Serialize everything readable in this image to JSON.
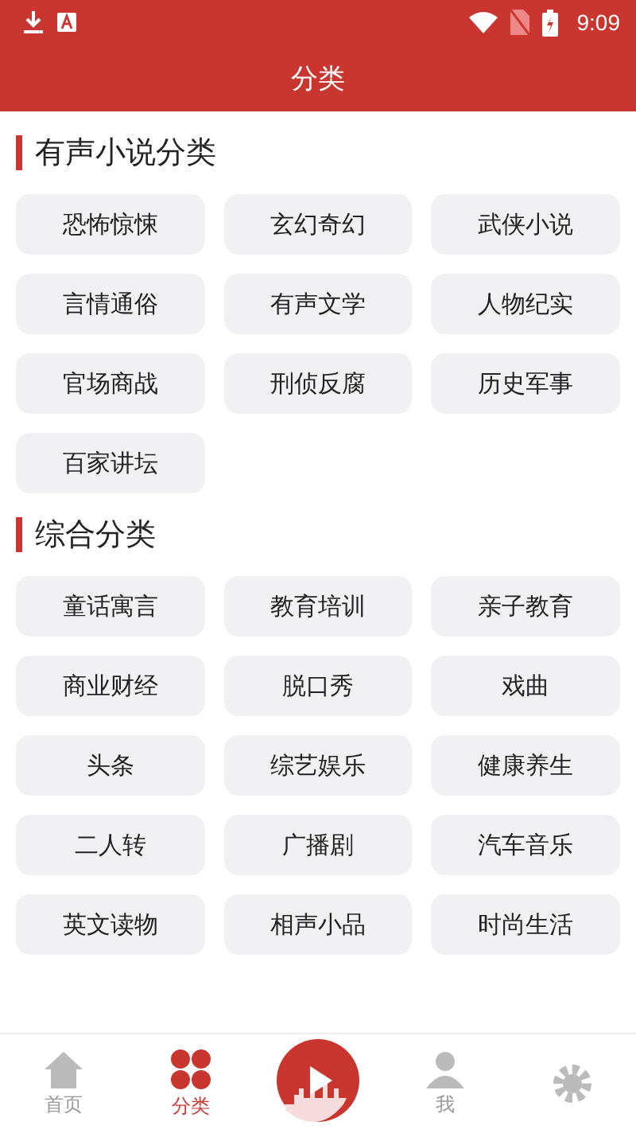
{
  "status_bar": {
    "time": "9:09"
  },
  "header": {
    "title": "分类"
  },
  "sections": [
    {
      "title": "有声小说分类",
      "items": [
        "恐怖惊悚",
        "玄幻奇幻",
        "武侠小说",
        "言情通俗",
        "有声文学",
        "人物纪实",
        "官场商战",
        "刑侦反腐",
        "历史军事",
        "百家讲坛"
      ]
    },
    {
      "title": "综合分类",
      "items": [
        "童话寓言",
        "教育培训",
        "亲子教育",
        "商业财经",
        "脱口秀",
        "戏曲",
        "头条",
        "综艺娱乐",
        "健康养生",
        "二人转",
        "广播剧",
        "汽车音乐",
        "英文读物",
        "相声小品",
        "时尚生活"
      ]
    }
  ],
  "nav": [
    {
      "kind": "home",
      "label": "首页",
      "selected": false
    },
    {
      "kind": "grid",
      "label": "分类",
      "selected": true
    },
    {
      "kind": "play",
      "selected": false
    },
    {
      "kind": "person",
      "label": "我",
      "selected": false
    },
    {
      "kind": "gear",
      "selected": false
    }
  ]
}
